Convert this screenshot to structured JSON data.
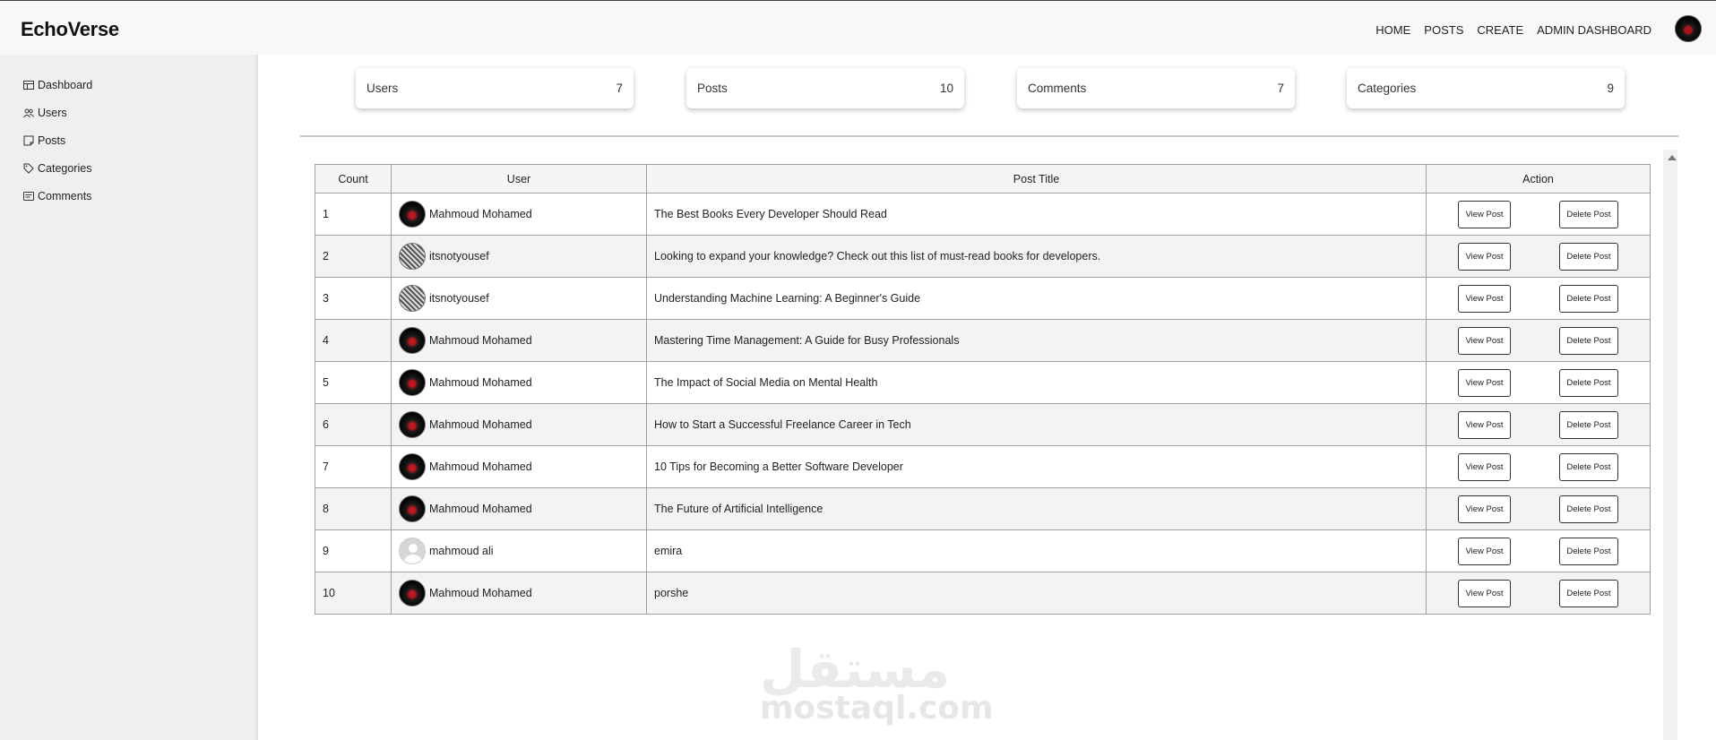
{
  "header": {
    "brand": "EchoVerse",
    "nav": [
      "HOME",
      "POSTS",
      "CREATE",
      "ADMIN DASHBOARD"
    ]
  },
  "sidebar": {
    "items": [
      {
        "label": "Dashboard",
        "icon": "table-icon"
      },
      {
        "label": "Users",
        "icon": "users-icon"
      },
      {
        "label": "Posts",
        "icon": "note-icon"
      },
      {
        "label": "Categories",
        "icon": "tag-icon"
      },
      {
        "label": "Comments",
        "icon": "comment-icon"
      }
    ]
  },
  "stats": [
    {
      "label": "Users",
      "value": "7"
    },
    {
      "label": "Posts",
      "value": "10"
    },
    {
      "label": "Comments",
      "value": "7"
    },
    {
      "label": "Categories",
      "value": "9"
    }
  ],
  "table": {
    "headers": [
      "Count",
      "User",
      "Post Title",
      "Action"
    ],
    "view_label": "View Post",
    "delete_label": "Delete Post",
    "rows": [
      {
        "count": "1",
        "user": "Mahmoud Mohamed",
        "avatar": "red",
        "title": "The Best Books Every Developer Should Read"
      },
      {
        "count": "2",
        "user": "itsnotyousef",
        "avatar": "gray",
        "title": "Looking to expand your knowledge? Check out this list of must-read books for developers."
      },
      {
        "count": "3",
        "user": "itsnotyousef",
        "avatar": "gray",
        "title": "Understanding Machine Learning: A Beginner's Guide"
      },
      {
        "count": "4",
        "user": "Mahmoud Mohamed",
        "avatar": "red",
        "title": "Mastering Time Management: A Guide for Busy Professionals"
      },
      {
        "count": "5",
        "user": "Mahmoud Mohamed",
        "avatar": "red",
        "title": "The Impact of Social Media on Mental Health"
      },
      {
        "count": "6",
        "user": "Mahmoud Mohamed",
        "avatar": "red",
        "title": "How to Start a Successful Freelance Career in Tech"
      },
      {
        "count": "7",
        "user": "Mahmoud Mohamed",
        "avatar": "red",
        "title": "10 Tips for Becoming a Better Software Developer"
      },
      {
        "count": "8",
        "user": "Mahmoud Mohamed",
        "avatar": "red",
        "title": "The Future of Artificial Intelligence"
      },
      {
        "count": "9",
        "user": "mahmoud ali",
        "avatar": "default",
        "title": "emira"
      },
      {
        "count": "10",
        "user": "Mahmoud Mohamed",
        "avatar": "red",
        "title": "porshe"
      }
    ]
  },
  "watermark": {
    "arabic": "مستقل",
    "latin": "mostaql.com"
  }
}
